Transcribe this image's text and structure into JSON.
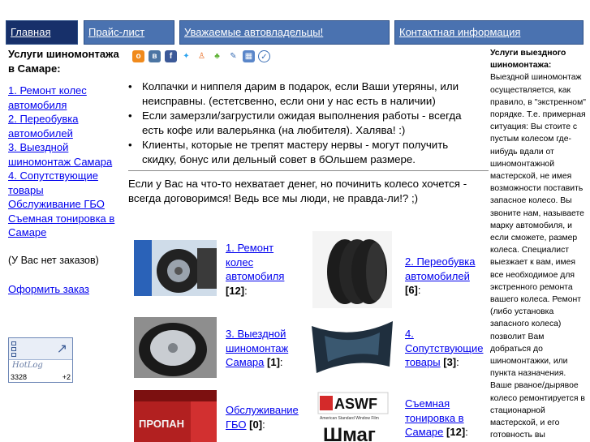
{
  "nav": {
    "items": [
      {
        "label": "Главная"
      },
      {
        "label": "Прайс-лист"
      },
      {
        "label": "Уважаемые автовладельцы!"
      },
      {
        "label": "Контактная информация"
      }
    ]
  },
  "left": {
    "title": "Услуги шиномонтажа в Самаре:",
    "menu": [
      "1. Ремонт колес автомобиля",
      "2. Переобувка автомобилей",
      "3. Выездной шиномонтаж Самара",
      "4. Сопутствующие товары",
      "Обслуживание ГБО",
      "Съемная тонировка в Самаре"
    ],
    "no_orders": "(У Вас нет заказов)",
    "order_link": "Оформить заказ"
  },
  "counter": {
    "logo": "HotLog",
    "visits": "3328",
    "delta": "+2"
  },
  "share": {
    "icons": [
      "odnoklassniki-icon",
      "vkontakte-icon",
      "facebook-icon",
      "twitter-icon",
      "moimir-icon",
      "liveinternet-icon",
      "bobrdobr-icon",
      "memori-icon",
      "yandex-icon"
    ]
  },
  "content": {
    "bullets": [
      "Колпачки и ниппеля дарим в подарок, если Ваши утеряны, или неисправны. (естетсвенно, если они у нас есть в наличии)",
      "Если замерзли/загрустили ожидая выполнения работы - всегда есть кофе или валерьянка (на любителя). Халява! :)",
      "Клиенты, которые не трепят мастеру нервы - могут получить скидку, бонус или дельный совет в бОльшем размере."
    ],
    "money_text": "Если у Вас на что-то нехватает денег, но починить колесо хочется - всегда договоримся! Ведь все мы люди, не правда-ли!? ;)"
  },
  "products": [
    {
      "label": "1. Ремонт колес автомобиля",
      "count": "[12]",
      "suffix": ":"
    },
    {
      "label": "2. Переобувка автомобилей",
      "count": "[6]",
      "suffix": ":"
    },
    {
      "label": "3. Выездной шиномонтаж Самара",
      "count": "[1]",
      "suffix": ":"
    },
    {
      "label": "4. Сопутствующие товары",
      "count": "[3]",
      "suffix": ":"
    },
    {
      "label": "Обслуживание ГБО",
      "count": "[0]",
      "suffix": ":"
    },
    {
      "label": "Съемная тонировка в Самаре",
      "count": "[12]",
      "suffix": ":"
    }
  ],
  "images": {
    "gbo_text": "ПРОПАН",
    "tint_brand": "ASWF",
    "tint_sub": "American Standard Window Film",
    "tint_brand2": "Шмаг"
  },
  "right": {
    "title": "Услуги выездного шиномонтажа:",
    "text": "Выездной шиномонтаж осуществляется, как правило, в \"экстренном\" порядке. Т.е. примерная ситуация: Вы стоите с пустым колесом где-нибудь вдали от шиномонтажной мастерской, не имея возможности поставить запасное колесо. Вы звоните нам, называете марку автомобиля, и если сможете, размер колеса. Специалист выезжает к вам, имея все необходимое для экстренного ремонта вашего колеса. Ремонт (либо установка запасного колеса) позволит Вам добраться до шиномонтажки, или пункта назначения. Ваше рваное/дырявое колесо ремонтируется в стационарной мастерской, и его готовность вы"
  },
  "colors": {
    "nav_bg": "#4a72b0",
    "nav_active": "#17306a",
    "link": "#0000ee"
  }
}
